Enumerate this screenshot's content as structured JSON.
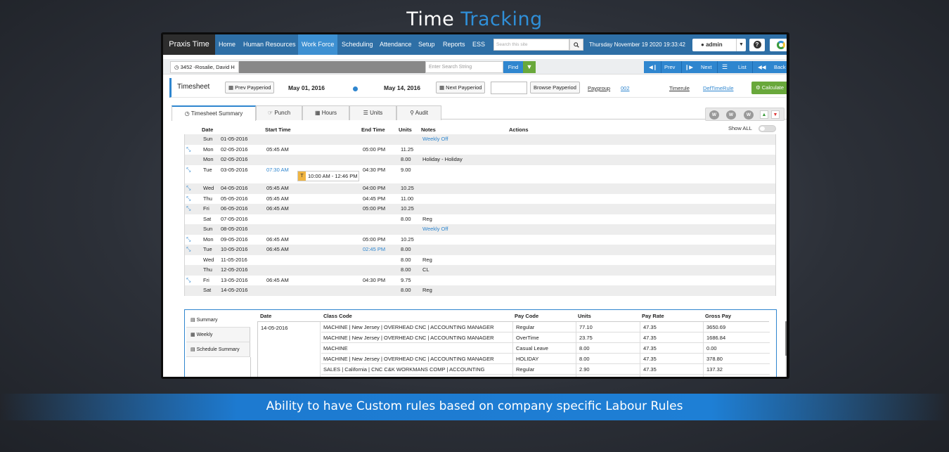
{
  "page_title": {
    "part1": "Time",
    "part2": "Tracking"
  },
  "footer_caption": "Ability to have Custom rules based on company specific Labour Rules",
  "app": {
    "brand": "Praxis Time",
    "nav": [
      "Home",
      "Human Resources",
      "Work Force",
      "Scheduling",
      "Attendance",
      "Setup",
      "Reports",
      "ESS"
    ],
    "active_nav": "Work Force",
    "search_placeholder": "Search this site",
    "datetime": "Thursday November 19 2020 19:33:42",
    "user": "admin",
    "accent_color": "#2f86cf",
    "nav_color": "#2e6fa6"
  },
  "toolbar": {
    "employee": "3452 -Rosalie, David H",
    "search_placeholder": "Enter Search String",
    "find": "Find",
    "prev": "Prev",
    "next": "Next",
    "list": "List",
    "back": "Back"
  },
  "timesheet_bar": {
    "label": "Timesheet",
    "prev_payperiod": "Prev Payperiod",
    "start_date": "May 01, 2016",
    "end_date": "May 14, 2016",
    "next_payperiod": "Next Payperiod",
    "browse_payperiod": "Browse Payperiod",
    "paygroup_label": "Paygroup",
    "paygroup_value": "002",
    "timerule_label": "Timerule",
    "timerule_value": "DefTimeRule",
    "calculate": "Calculate"
  },
  "tabs": [
    "Timesheet Summary",
    "Punch",
    "Hours",
    "Units",
    "Audit"
  ],
  "w_badges": [
    "W",
    "W",
    "W"
  ],
  "show_all": "Show ALL",
  "columns": {
    "date": "Date",
    "start": "Start Time",
    "end": "End Time",
    "units": "Units",
    "notes": "Notes",
    "actions": "Actions"
  },
  "rows": [
    {
      "day": "Sun",
      "date": "01-05-2016",
      "start": "",
      "end": "",
      "units": "",
      "note": "Weekly Off"
    },
    {
      "day": "Mon",
      "date": "02-05-2016",
      "start": "05:45 AM",
      "end": "05:00 PM",
      "units": "11.25",
      "note": ""
    },
    {
      "day": "Mon",
      "date": "02-05-2016",
      "start": "",
      "end": "",
      "units": "8.00",
      "note": "Holiday - Holiday"
    },
    {
      "day": "Tue",
      "date": "03-05-2016",
      "start": "07:30 AM",
      "end": "04:30 PM",
      "units": "9.00",
      "note": ""
    },
    {
      "day": "Wed",
      "date": "04-05-2016",
      "start": "05:45 AM",
      "end": "04:00 PM",
      "units": "10.25",
      "note": ""
    },
    {
      "day": "Thu",
      "date": "05-05-2016",
      "start": "05:45 AM",
      "end": "04:45 PM",
      "units": "11.00",
      "note": ""
    },
    {
      "day": "Fri",
      "date": "06-05-2016",
      "start": "06:45 AM",
      "end": "05:00 PM",
      "units": "10.25",
      "note": ""
    },
    {
      "day": "Sat",
      "date": "07-05-2016",
      "start": "",
      "end": "",
      "units": "8.00",
      "note": "Reg"
    },
    {
      "day": "Sun",
      "date": "08-05-2016",
      "start": "",
      "end": "",
      "units": "",
      "note": "Weekly Off"
    },
    {
      "day": "Mon",
      "date": "09-05-2016",
      "start": "06:45 AM",
      "end": "05:00 PM",
      "units": "10.25",
      "note": ""
    },
    {
      "day": "Tue",
      "date": "10-05-2016",
      "start": "06:45 AM",
      "end": "02:45 PM",
      "units": "8.00",
      "note": ""
    },
    {
      "day": "Wed",
      "date": "11-05-2016",
      "start": "",
      "end": "",
      "units": "8.00",
      "note": "Reg"
    },
    {
      "day": "Thu",
      "date": "12-05-2016",
      "start": "",
      "end": "",
      "units": "8.00",
      "note": "CL"
    },
    {
      "day": "Fri",
      "date": "13-05-2016",
      "start": "06:45 AM",
      "end": "04:30 PM",
      "units": "9.75",
      "note": ""
    },
    {
      "day": "Sat",
      "date": "14-05-2016",
      "start": "",
      "end": "",
      "units": "8.00",
      "note": "Reg"
    }
  ],
  "punch_popup": {
    "badge": "T",
    "text": "10:00 AM - 12:46 PM"
  },
  "summary_nav": [
    "Summary",
    "Weekly",
    "Schedule Summary"
  ],
  "summary_columns": {
    "date": "Date",
    "class_code": "Class Code",
    "pay_code": "Pay Code",
    "units": "Units",
    "pay_rate": "Pay Rate",
    "gross_pay": "Gross Pay"
  },
  "summary_date": "14-05-2016",
  "summary_rows": [
    {
      "class_code": "MACHINE | New Jersey | OVERHEAD CNC | ACCOUNTING MANAGER",
      "pay_code": "Regular",
      "units": "77.10",
      "pay_rate": "47.35",
      "gross_pay": "3650.69"
    },
    {
      "class_code": "MACHINE | New Jersey | OVERHEAD CNC | ACCOUNTING MANAGER",
      "pay_code": "OverTime",
      "units": "23.75",
      "pay_rate": "47.35",
      "gross_pay": "1686.84"
    },
    {
      "class_code": "MACHINE",
      "pay_code": "Casual Leave",
      "units": "8.00",
      "pay_rate": "47.35",
      "gross_pay": "0.00"
    },
    {
      "class_code": "MACHINE | New Jersey | OVERHEAD CNC | ACCOUNTING MANAGER",
      "pay_code": "HOLIDAY",
      "units": "8.00",
      "pay_rate": "47.35",
      "gross_pay": "378.80"
    },
    {
      "class_code": "SALES | California | CNC C&K WORKMANS COMP | ACCOUNTING",
      "pay_code": "Regular",
      "units": "2.90",
      "pay_rate": "47.35",
      "gross_pay": "137.32"
    }
  ]
}
